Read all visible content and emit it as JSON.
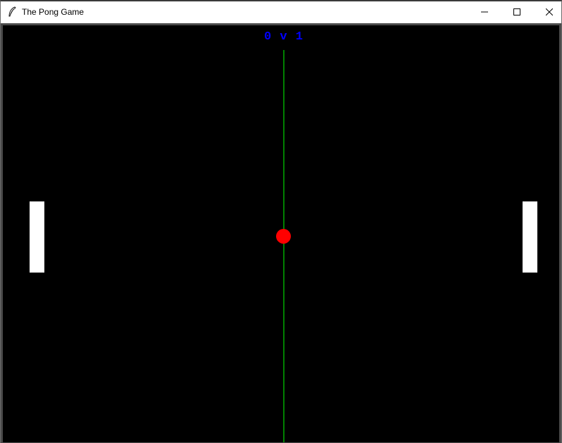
{
  "window": {
    "title": "The Pong Game",
    "controls": [
      "minimize-icon",
      "maximize-icon",
      "close-icon"
    ]
  },
  "game": {
    "score": {
      "text": "0 v 1",
      "left_player": 0,
      "right_player": 1,
      "color": "#0000ff"
    },
    "colors": {
      "background": "#000000",
      "center_line": "#008000",
      "paddle": "#ffffff",
      "ball": "#ff0000"
    }
  }
}
